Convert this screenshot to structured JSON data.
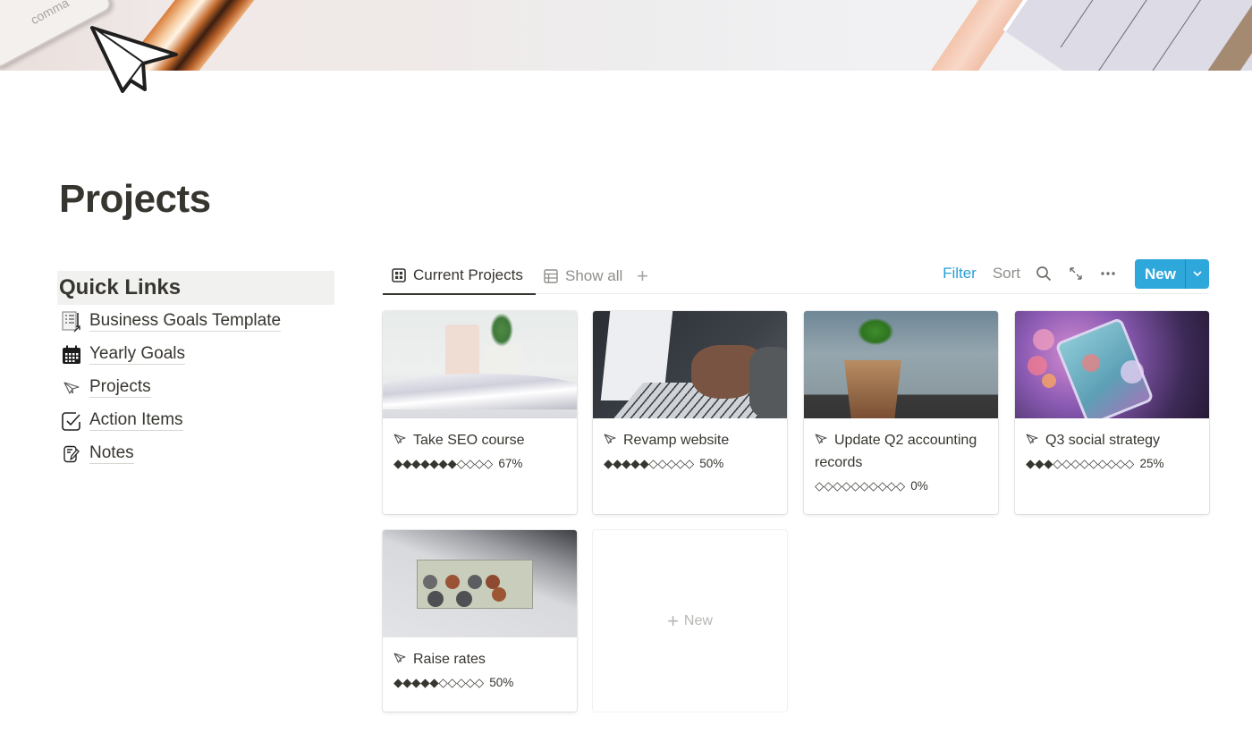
{
  "page": {
    "title": "Projects",
    "icon": "paper-plane-icon"
  },
  "quick_links": {
    "heading": "Quick Links",
    "items": [
      {
        "label": "Business Goals Template",
        "icon": "template-doc-icon"
      },
      {
        "label": "Yearly Goals",
        "icon": "calendar-icon"
      },
      {
        "label": "Projects",
        "icon": "paper-plane-icon"
      },
      {
        "label": "Action Items",
        "icon": "checkbox-icon"
      },
      {
        "label": "Notes",
        "icon": "note-icon"
      }
    ]
  },
  "database": {
    "tabs": [
      {
        "label": "Current Projects",
        "icon": "gallery-icon",
        "active": true
      },
      {
        "label": "Show all",
        "icon": "table-icon",
        "active": false
      }
    ],
    "add_view_label": "+",
    "toolbar": {
      "filter": "Filter",
      "sort": "Sort",
      "search_icon": "search-icon",
      "expand_icon": "expand-icon",
      "more_icon": "more-icon",
      "new_button": "New",
      "accent_color": "#2ea7db",
      "filter_color": "#2a9fd6"
    },
    "cards": [
      {
        "name": "Take SEO course",
        "image": "open-book",
        "progress_bar": "◆◆◆◆◆◆◆◇◇◇◇",
        "progress_pct": "67%",
        "progress_value": 0.67
      },
      {
        "name": "Revamp website",
        "image": "laptop-typing",
        "progress_bar": "◆◆◆◆◆◇◇◇◇◇",
        "progress_pct": "50%",
        "progress_value": 0.5
      },
      {
        "name": "Update Q2 accounting records",
        "image": "coins-jar-sprout",
        "progress_bar": "◇◇◇◇◇◇◇◇◇◇",
        "progress_pct": "0%",
        "progress_value": 0
      },
      {
        "name": "Q3 social strategy",
        "image": "phone-bokeh",
        "progress_bar": "◆◆◆◇◇◇◇◇◇◇◇◇",
        "progress_pct": "25%",
        "progress_value": 0.25
      },
      {
        "name": "Raise rates",
        "image": "dollar-coins",
        "progress_bar": "◆◆◆◆◆◇◇◇◇◇",
        "progress_pct": "50%",
        "progress_value": 0.5
      }
    ],
    "new_card_label": "New"
  }
}
